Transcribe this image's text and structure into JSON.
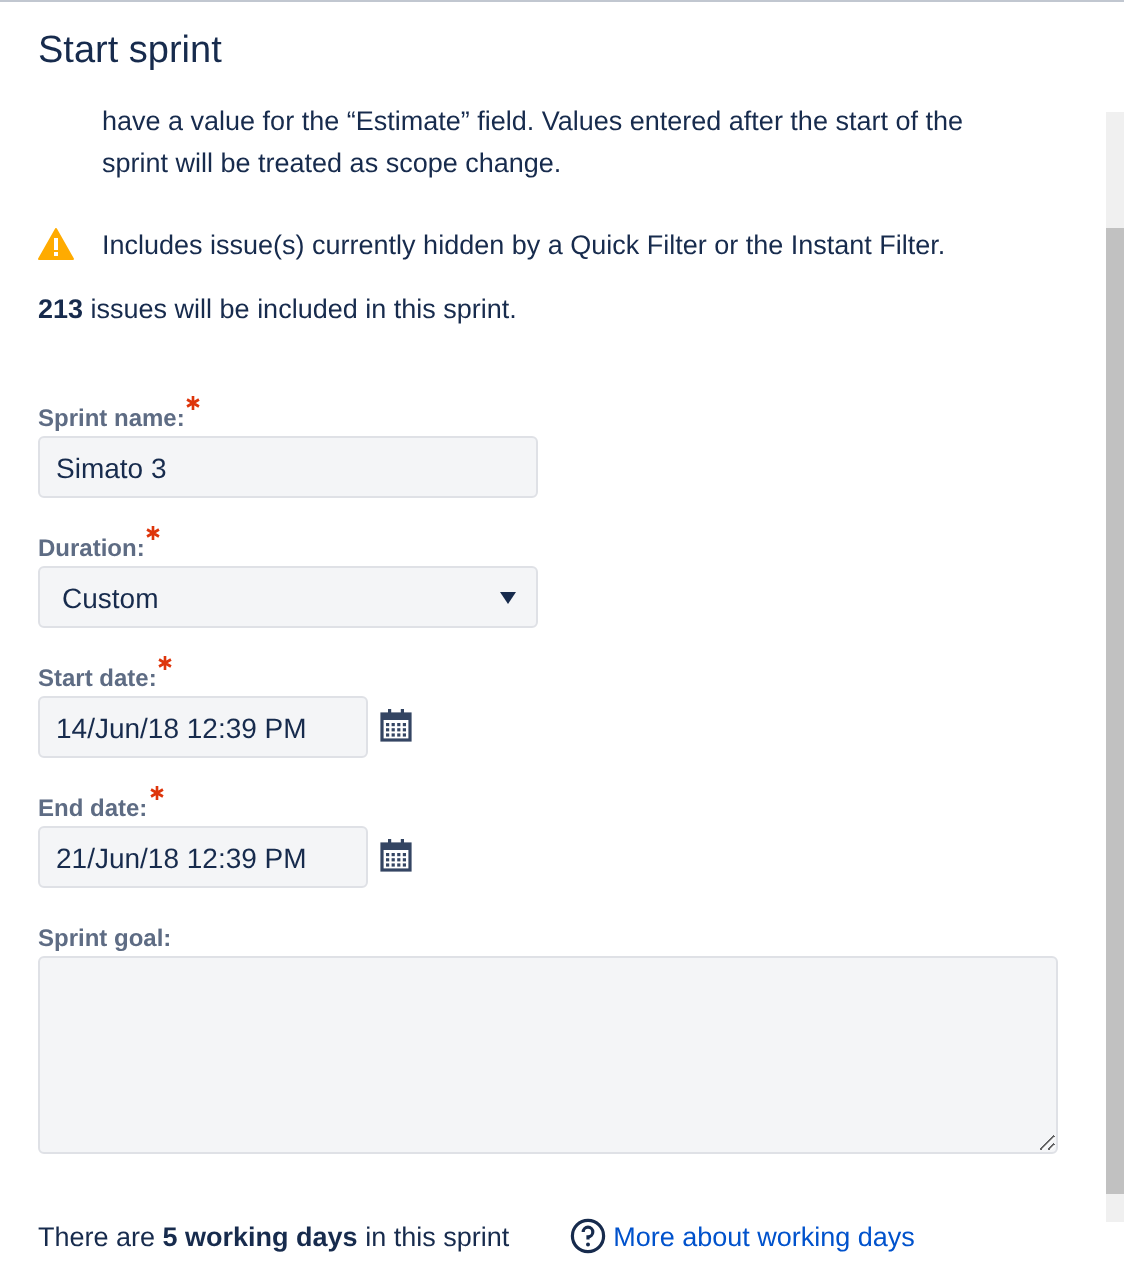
{
  "dialog": {
    "title": "Start sprint"
  },
  "intro_text": "have a value for the “Estimate” field. Values entered after the start of the sprint will be treated as scope change.",
  "warning": {
    "text": "Includes issue(s) currently hidden by a Quick Filter or the Instant Filter."
  },
  "summary": "**213** issues will be included in this sprint.",
  "fields": [
    {
      "kind": "text",
      "label": "Sprint name:",
      "required": true,
      "value": "Simato 3"
    },
    {
      "kind": "select",
      "label": "Duration:",
      "required": true,
      "value": "Custom"
    },
    {
      "kind": "date",
      "label": "Start date:",
      "required": true,
      "value": "14/Jun/18 12:39 PM"
    },
    {
      "kind": "date",
      "label": "End date:",
      "required": true,
      "value": "21/Jun/18 12:39 PM"
    },
    {
      "kind": "textarea",
      "label": "Sprint goal:"
    }
  ],
  "working_days": {
    "text": "There are **5 working days** in this sprint",
    "link": "More about working days"
  }
}
